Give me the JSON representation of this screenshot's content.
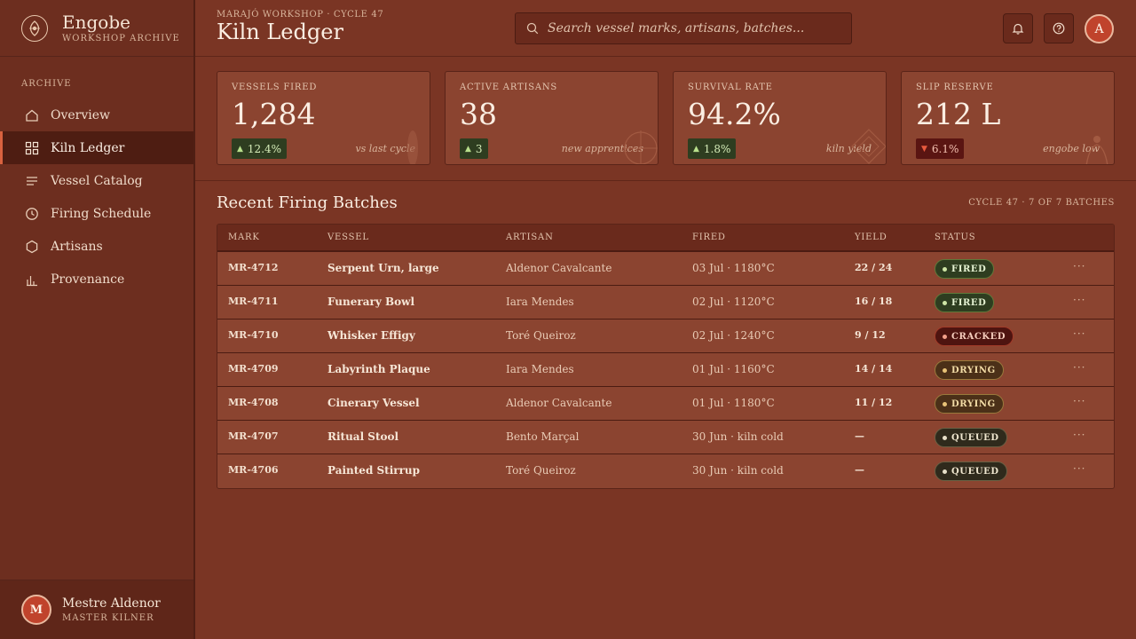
{
  "brand": {
    "name": "Engobe",
    "subtitle": "WORKSHOP ARCHIVE"
  },
  "sidebar": {
    "section_label": "ARCHIVE",
    "items": [
      {
        "label": "Overview",
        "icon": "home-icon"
      },
      {
        "label": "Kiln Ledger",
        "icon": "grid-icon",
        "active": true
      },
      {
        "label": "Vessel Catalog",
        "icon": "list-icon"
      },
      {
        "label": "Firing Schedule",
        "icon": "clock-icon"
      },
      {
        "label": "Artisans",
        "icon": "hexagon-icon"
      },
      {
        "label": "Provenance",
        "icon": "bar-chart-icon"
      }
    ]
  },
  "user": {
    "initial": "M",
    "name": "Mestre Aldenor",
    "role": "MASTER KILNER"
  },
  "header": {
    "breadcrumb": "MARAJÓ WORKSHOP · CYCLE 47",
    "title": "Kiln Ledger",
    "search_placeholder": "Search vessel marks, artisans, batches...",
    "avatar_initial": "A"
  },
  "kpis": [
    {
      "label": "VESSELS FIRED",
      "value": "1,284",
      "delta": "12.4%",
      "direction": "up",
      "note": "vs last cycle"
    },
    {
      "label": "ACTIVE ARTISANS",
      "value": "38",
      "delta": "3",
      "direction": "up",
      "note": "new apprentices"
    },
    {
      "label": "SURVIVAL RATE",
      "value": "94.2%",
      "delta": "1.8%",
      "direction": "up",
      "note": "kiln yield"
    },
    {
      "label": "SLIP RESERVE",
      "value": "212 L",
      "delta": "6.1%",
      "direction": "down",
      "note": "engobe low"
    }
  ],
  "batches": {
    "title": "Recent Firing Batches",
    "meta": "CYCLE 47 · 7 OF 7 BATCHES",
    "columns": [
      "MARK",
      "VESSEL",
      "ARTISAN",
      "FIRED",
      "YIELD",
      "STATUS"
    ],
    "rows": [
      {
        "mark": "MR-4712",
        "vessel": "Serpent Urn, large",
        "artisan": "Aldenor Cavalcante",
        "fired": "03 Jul · 1180°C",
        "yield": "22 / 24",
        "status": "FIRED",
        "status_kind": "fired"
      },
      {
        "mark": "MR-4711",
        "vessel": "Funerary Bowl",
        "artisan": "Iara Mendes",
        "fired": "02 Jul · 1120°C",
        "yield": "16 / 18",
        "status": "FIRED",
        "status_kind": "fired"
      },
      {
        "mark": "MR-4710",
        "vessel": "Whisker Effigy",
        "artisan": "Toré Queiroz",
        "fired": "02 Jul · 1240°C",
        "yield": "9 / 12",
        "status": "CRACKED",
        "status_kind": "cracked"
      },
      {
        "mark": "MR-4709",
        "vessel": "Labyrinth Plaque",
        "artisan": "Iara Mendes",
        "fired": "01 Jul · 1160°C",
        "yield": "14 / 14",
        "status": "DRYING",
        "status_kind": "drying"
      },
      {
        "mark": "MR-4708",
        "vessel": "Cinerary Vessel",
        "artisan": "Aldenor Cavalcante",
        "fired": "01 Jul · 1180°C",
        "yield": "11 / 12",
        "status": "DRYING",
        "status_kind": "drying"
      },
      {
        "mark": "MR-4707",
        "vessel": "Ritual Stool",
        "artisan": "Bento Marçal",
        "fired": "30 Jun · kiln cold",
        "yield": "—",
        "status": "QUEUED",
        "status_kind": "queued"
      },
      {
        "mark": "MR-4706",
        "vessel": "Painted Stirrup",
        "artisan": "Toré Queiroz",
        "fired": "30 Jun · kiln cold",
        "yield": "—",
        "status": "QUEUED",
        "status_kind": "queued"
      }
    ],
    "row_action": "···"
  },
  "colors": {
    "accent": "#d9623f",
    "background": "#7a3524",
    "sidebar": "#6d2e1f",
    "card": "#8b4430"
  }
}
